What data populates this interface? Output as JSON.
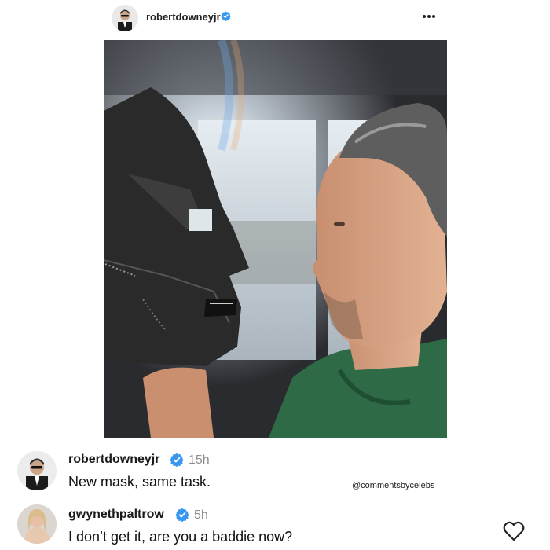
{
  "post": {
    "username": "robertdowneyjr",
    "more_icon": "more-options-icon"
  },
  "comments": [
    {
      "username": "robertdowneyjr",
      "time": "15h",
      "text": "New mask, same task."
    },
    {
      "username": "gwynethpaltrow",
      "time": "5h",
      "text": "I don’t get it, are you a baddie now?"
    }
  ],
  "watermark": "@commentsbycelebs",
  "colors": {
    "verified": "#3897f0",
    "muted": "#8e8e8e",
    "hoodie": "#2e6a46"
  },
  "icons": {
    "verified": "verified-badge-icon",
    "like": "heart-outline-icon"
  }
}
